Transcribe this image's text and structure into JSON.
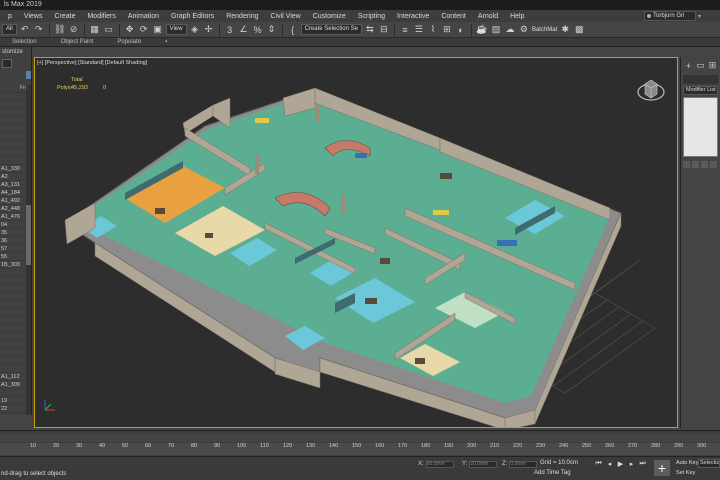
{
  "window": {
    "title": "ls Max 2019"
  },
  "menu": [
    "p",
    "Views",
    "Create",
    "Modifiers",
    "Animation",
    "Graph Editors",
    "Rendering",
    "Civil View",
    "Customize",
    "Scripting",
    "Interactive",
    "Content",
    "Arnold",
    "Help"
  ],
  "user": {
    "name": "Torbjorn Gri"
  },
  "toolbar": {
    "filter_all": "All",
    "view_dropdown": "View",
    "selection_set": "Create Selection Se",
    "batchmat": "BatchMat",
    "icons": [
      "undo-icon",
      "redo-icon",
      "link-icon",
      "unlink-icon",
      "select-icon",
      "move-icon",
      "rotate-icon",
      "scale-icon",
      "snap-icon",
      "angle-snap-icon",
      "percent-snap-icon",
      "spinner-snap-icon",
      "mirror-icon",
      "align-icon",
      "layer-icon",
      "curve-editor-icon",
      "schematic-icon",
      "material-editor-icon",
      "render-setup-icon",
      "render-frame-icon",
      "render-icon"
    ]
  },
  "ribbon": {
    "tabs": [
      "Selection",
      "Object Paint",
      "Populate"
    ]
  },
  "scene_explorer": {
    "header": "stomize",
    "column_tag": "Froz",
    "items": [
      "",
      "",
      "",
      "",
      "",
      "",
      "",
      "",
      "",
      "",
      "A1_330",
      "A2",
      "A3_131",
      "A4_184",
      "A1_492",
      "A2_448",
      "A1_476",
      "04",
      "35",
      "36",
      "57",
      "55",
      "1B_303",
      "",
      "",
      "",
      "",
      "",
      "",
      "",
      "",
      "",
      "",
      "",
      "",
      "",
      "A1_112",
      "A1_309",
      "",
      "19",
      "22"
    ]
  },
  "viewport": {
    "label": "[+] [Perspective] [Standard] [Default Shading]",
    "stats_total": "Total",
    "stats_polys_label": "Polys:",
    "stats_polys_value": "45,293",
    "stats_second": "0"
  },
  "command_panel": {
    "tabs": [
      "create-icon",
      "modify-icon",
      "hierarchy-icon"
    ],
    "modifier_list": "Modifier List"
  },
  "timeline": {
    "ticks": [
      "10",
      "20",
      "30",
      "40",
      "50",
      "60",
      "70",
      "80",
      "90",
      "100",
      "110",
      "120",
      "130",
      "140",
      "150",
      "160",
      "170",
      "180",
      "190",
      "200",
      "210",
      "220",
      "230",
      "240",
      "250",
      "260",
      "270",
      "280",
      "290",
      "300"
    ]
  },
  "status": {
    "prompt": "nd-drag to select objects",
    "x_label": "X:",
    "x_value": "90.0mm",
    "y_label": "Y:",
    "y_value": "20.0mm",
    "z_label": "Z:",
    "z_value": "0.0mm",
    "grid": "Grid = 10.0cm",
    "add_time_tag": "Add Time Tag",
    "auto_key": "Auto Key",
    "set_key": "Set Key",
    "selection_set": "Selection"
  },
  "colors": {
    "accent_yellow": "#c8a000",
    "floor_green": "#5cae92",
    "wall_beige": "#b0a696",
    "floor_orange": "#e8a040",
    "floor_cream": "#e9d8a8",
    "floor_blue": "#6ac8d8"
  }
}
